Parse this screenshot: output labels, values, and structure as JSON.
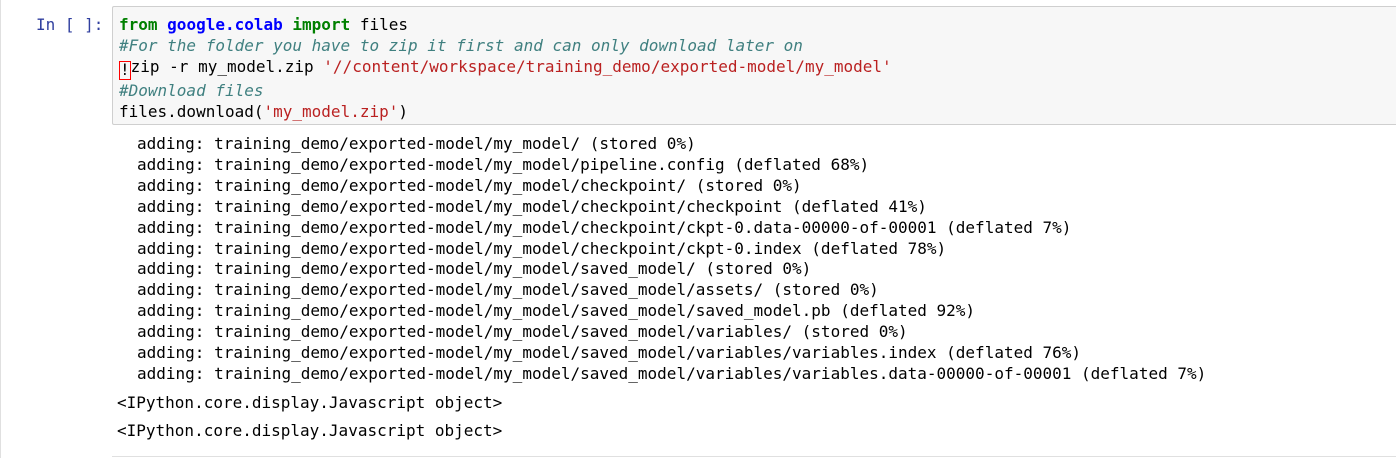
{
  "cell": {
    "prompt": "In [ ]:",
    "code": {
      "line1": {
        "from": "from",
        "module": "google.colab",
        "import": "import",
        "rest": " files"
      },
      "line2": "#For the folder you have to zip it first and can only download later on",
      "line3": {
        "bang": "!",
        "cmd": "zip -r my_model.zip ",
        "path": "'//content/workspace/training_demo/exported-model/my_model'"
      },
      "line4": "#Download files",
      "line5": {
        "call": "files.download(",
        "arg": "'my_model.zip'",
        "close": ")"
      }
    },
    "output": {
      "stream": [
        "adding: training_demo/exported-model/my_model/ (stored 0%)",
        "adding: training_demo/exported-model/my_model/pipeline.config (deflated 68%)",
        "adding: training_demo/exported-model/my_model/checkpoint/ (stored 0%)",
        "adding: training_demo/exported-model/my_model/checkpoint/checkpoint (deflated 41%)",
        "adding: training_demo/exported-model/my_model/checkpoint/ckpt-0.data-00000-of-00001 (deflated 7%)",
        "adding: training_demo/exported-model/my_model/checkpoint/ckpt-0.index (deflated 78%)",
        "adding: training_demo/exported-model/my_model/saved_model/ (stored 0%)",
        "adding: training_demo/exported-model/my_model/saved_model/assets/ (stored 0%)",
        "adding: training_demo/exported-model/my_model/saved_model/saved_model.pb (deflated 92%)",
        "adding: training_demo/exported-model/my_model/saved_model/variables/ (stored 0%)",
        "adding: training_demo/exported-model/my_model/saved_model/variables/variables.index (deflated 76%)",
        "adding: training_demo/exported-model/my_model/saved_model/variables/variables.data-00000-of-00001 (deflated 7%)"
      ],
      "objects": [
        "<IPython.core.display.Javascript object>",
        "<IPython.core.display.Javascript object>"
      ]
    }
  },
  "colors": {
    "prompt": "#303f9f",
    "keyword": "#008000",
    "module": "#0000ff",
    "comment": "#408080",
    "string": "#ba2121",
    "input_bg": "#f7f7f7",
    "input_border": "#cfcfcf",
    "bang_border": "#ff0000"
  }
}
